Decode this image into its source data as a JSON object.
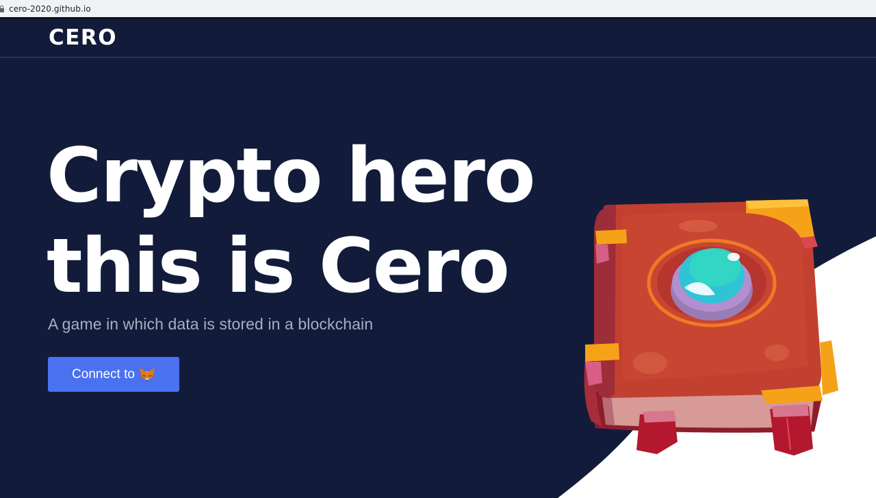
{
  "browser": {
    "url": "cero-2020.github.io"
  },
  "header": {
    "logo": "CERO"
  },
  "hero": {
    "title_line1": "Crypto hero",
    "title_line2": "this is Cero",
    "subtitle": "A game in which data is stored in a blockchain",
    "connect_label": "Connect to"
  },
  "icons": {
    "connect_icon": "metamask-fox-icon",
    "illustration": "magic-book-illustration"
  },
  "colors": {
    "background": "#121b3a",
    "button": "#4a71f0",
    "subtitle": "#a9afc0",
    "book_cover": "#c2402f",
    "gem": "#2ec4d6"
  }
}
